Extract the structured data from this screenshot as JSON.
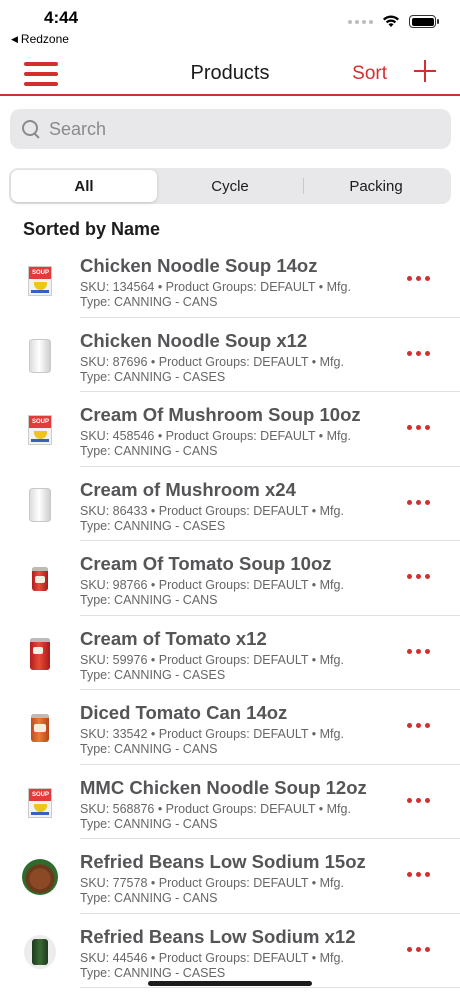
{
  "status_bar": {
    "time": "4:44",
    "back_app": "Redzone"
  },
  "nav": {
    "title": "Products",
    "sort_label": "Sort"
  },
  "search": {
    "placeholder": "Search"
  },
  "segments": [
    {
      "label": "All",
      "active": true
    },
    {
      "label": "Cycle",
      "active": false
    },
    {
      "label": "Packing",
      "active": false
    }
  ],
  "section_header": "Sorted by Name",
  "products": [
    {
      "name": "Chicken Noodle Soup 14oz",
      "meta1": "SKU: 134564 • Product Groups: DEFAULT • Mfg.",
      "meta2": "Type: CANNING - CANS",
      "thumb": "soup-box"
    },
    {
      "name": "Chicken Noodle Soup x12",
      "meta1": "SKU: 87696 • Product Groups: DEFAULT • Mfg.",
      "meta2": "Type: CANNING - CASES",
      "thumb": "plain-can"
    },
    {
      "name": "Cream Of Mushroom Soup 10oz",
      "meta1": "SKU: 458546 • Product Groups: DEFAULT • Mfg.",
      "meta2": "Type: CANNING - CANS",
      "thumb": "soup-box"
    },
    {
      "name": "Cream of Mushroom x24",
      "meta1": "SKU: 86433 • Product Groups: DEFAULT • Mfg.",
      "meta2": "Type: CANNING - CASES",
      "thumb": "plain-can"
    },
    {
      "name": "Cream Of Tomato Soup 10oz",
      "meta1": "SKU: 98766 • Product Groups: DEFAULT • Mfg.",
      "meta2": "Type: CANNING - CANS",
      "thumb": "red-can"
    },
    {
      "name": "Cream of Tomato x12",
      "meta1": "SKU: 59976 • Product Groups: DEFAULT • Mfg.",
      "meta2": "Type: CANNING - CASES",
      "thumb": "red-can-big"
    },
    {
      "name": "Diced Tomato Can 14oz",
      "meta1": "SKU: 33542 • Product Groups: DEFAULT • Mfg.",
      "meta2": "Type: CANNING - CANS",
      "thumb": "orange-can"
    },
    {
      "name": "MMC Chicken Noodle Soup 12oz",
      "meta1": "SKU: 568876 • Product Groups: DEFAULT • Mfg.",
      "meta2": "Type: CANNING - CANS",
      "thumb": "soup-box"
    },
    {
      "name": "Refried Beans Low Sodium 15oz",
      "meta1": "SKU: 77578 • Product Groups: DEFAULT • Mfg.",
      "meta2": "Type: CANNING - CANS",
      "thumb": "beans-round"
    },
    {
      "name": "Refried Beans Low Sodium x12",
      "meta1": "SKU: 44546 • Product Groups: DEFAULT • Mfg.",
      "meta2": "Type: CANNING - CASES",
      "thumb": "beans-can"
    }
  ],
  "soup_label": "SOUP",
  "colors": {
    "accent": "#d32f2f"
  }
}
